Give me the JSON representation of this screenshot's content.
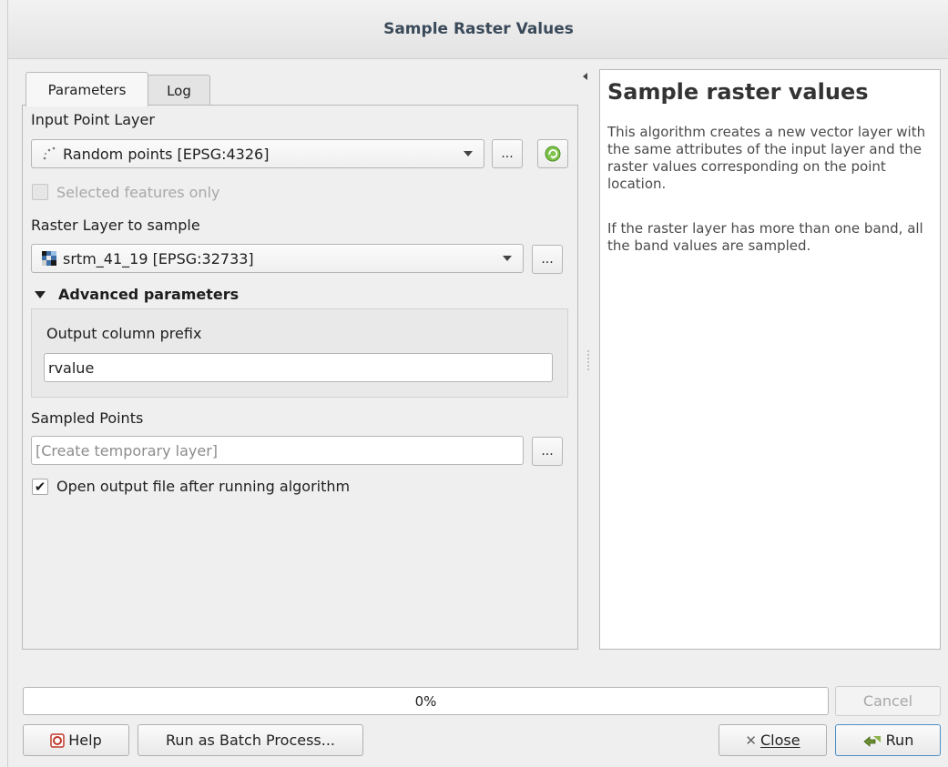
{
  "window": {
    "title": "Sample Raster Values"
  },
  "tabs": [
    {
      "label": "Parameters"
    },
    {
      "label": "Log"
    }
  ],
  "params": {
    "input_point_layer": {
      "label": "Input Point Layer",
      "value": "Random points [EPSG:4326]"
    },
    "selected_features_only": {
      "label": "Selected features only",
      "checked": false,
      "enabled": false
    },
    "raster_layer": {
      "label": "Raster Layer to sample",
      "value": "srtm_41_19 [EPSG:32733]"
    },
    "advanced": {
      "header": "Advanced parameters",
      "output_column_prefix": {
        "label": "Output column prefix",
        "value": "rvalue"
      }
    },
    "sampled_points": {
      "label": "Sampled Points",
      "placeholder": "[Create temporary layer]"
    },
    "open_output": {
      "label": "Open output file after running algorithm",
      "checked": true
    }
  },
  "browse_label": "...",
  "help": {
    "title": "Sample raster values",
    "paragraph1": "This algorithm creates a new vector layer with the same attributes of the input layer and the raster values corresponding on the point location.",
    "paragraph2": "If the raster layer has more than one band, all the band values are sampled."
  },
  "progress": {
    "text": "0%",
    "value": 0
  },
  "buttons": {
    "cancel": "Cancel",
    "help": "Help",
    "batch": "Run as Batch Process...",
    "close": "Close",
    "run": "Run"
  }
}
